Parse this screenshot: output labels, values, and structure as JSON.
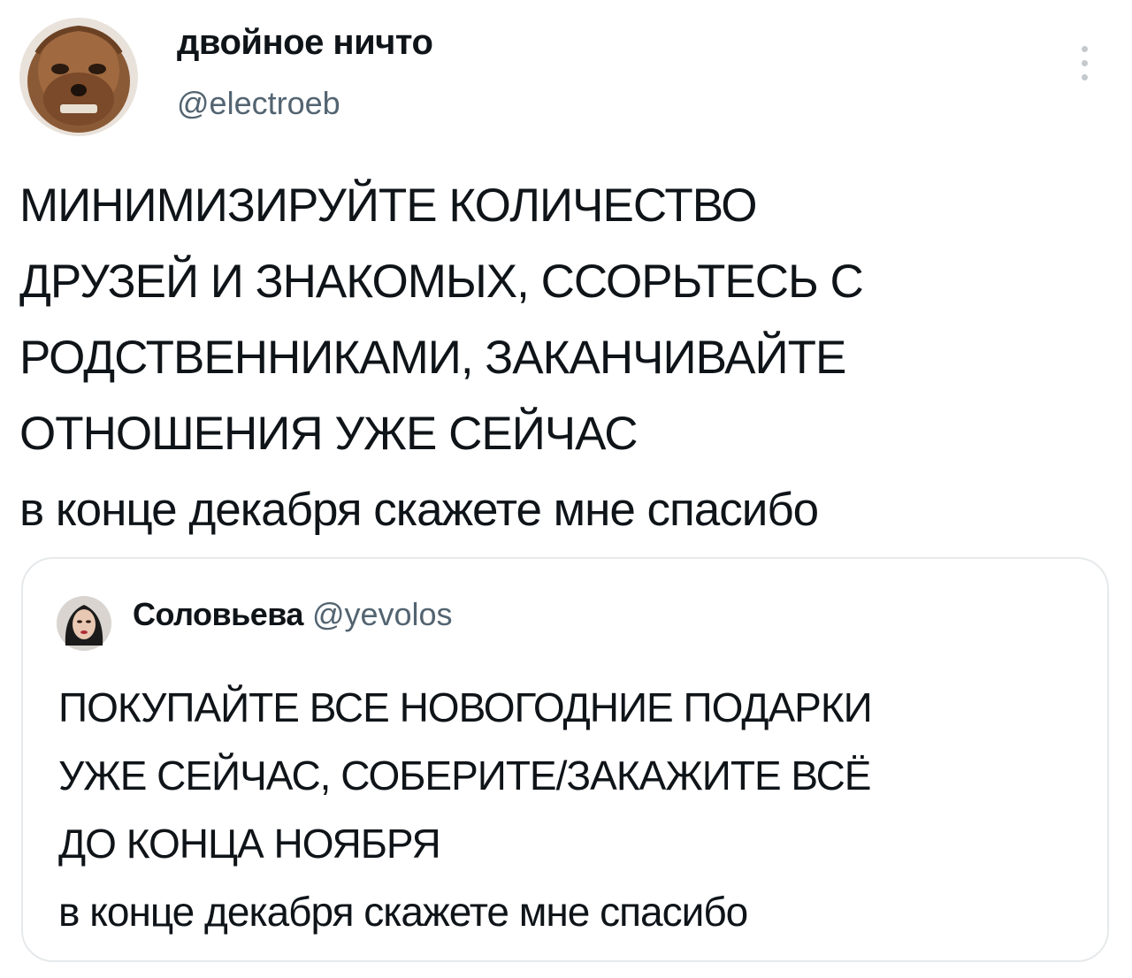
{
  "author": {
    "display_name": "двойное ничто",
    "handle": "@electroeb"
  },
  "tweet": {
    "lines": [
      "МИНИМИЗИРУЙТЕ КОЛИЧЕСТВО",
      "ДРУЗЕЙ И ЗНАКОМЫХ, ССОРЬТЕСЬ С",
      "РОДСТВЕННИКАМИ, ЗАКАНЧИВАЙТЕ",
      "ОТНОШЕНИЯ УЖЕ СЕЙЧАС",
      "в конце декабря скажете мне спасибо"
    ]
  },
  "quoted_tweet": {
    "display_name": "Соловьева",
    "handle": "@yevolos",
    "lines": [
      "ПОКУПАЙТЕ ВСЕ НОВОГОДНИЕ ПОДАРКИ",
      "УЖЕ СЕЙЧАС, СОБЕРИТЕ/ЗАКАЖИТЕ ВСЁ",
      "ДО КОНЦА НОЯБРЯ",
      "в конце декабря скажете мне спасибо"
    ]
  },
  "icons": {
    "more": "vertical-ellipsis-icon"
  },
  "colors": {
    "text": "#0f1419",
    "secondary_text": "#536471",
    "border": "#e6e9eb"
  }
}
